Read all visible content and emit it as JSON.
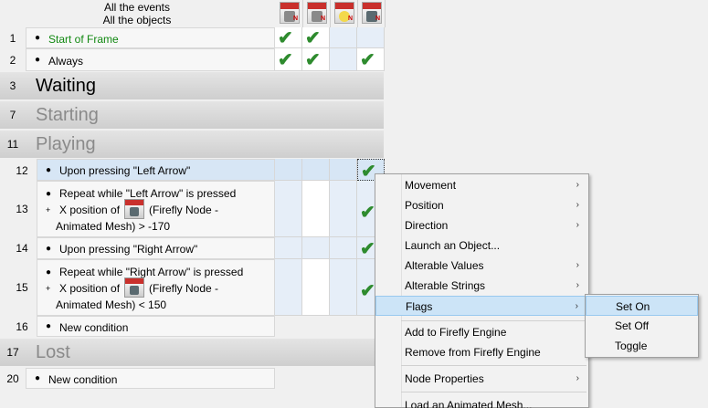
{
  "header": {
    "line1": "All the events",
    "line2": "All the objects"
  },
  "objects": [
    {
      "icon": "firefly-engine-icon"
    },
    {
      "icon": "firefly-mesh-icon"
    },
    {
      "icon": "firefly-light-icon"
    },
    {
      "icon": "firefly-node-icon"
    }
  ],
  "rows": {
    "r1": {
      "num": "1",
      "text": "Start of Frame"
    },
    "r2": {
      "num": "2",
      "text": "Always"
    },
    "g3": {
      "num": "3",
      "title": "Waiting"
    },
    "g7": {
      "num": "7",
      "title": "Starting"
    },
    "g11": {
      "num": "11",
      "title": "Playing"
    },
    "r12": {
      "num": "12",
      "text": "Upon pressing \"Left Arrow\""
    },
    "r13": {
      "num": "13",
      "line1": "Repeat while \"Left Arrow\" is pressed",
      "line2a": "X position of",
      "line2b": "(Firefly Node -",
      "line3": "Animated Mesh) > -170"
    },
    "r14": {
      "num": "14",
      "text": "Upon pressing \"Right Arrow\""
    },
    "r15": {
      "num": "15",
      "line1": "Repeat while \"Right Arrow\" is pressed",
      "line2a": "X position of",
      "line2b": "(Firefly Node -",
      "line3": "Animated Mesh) < 150"
    },
    "r16": {
      "num": "16",
      "text": "New condition"
    },
    "g17": {
      "num": "17",
      "title": "Lost"
    },
    "r20": {
      "num": "20",
      "text": "New condition"
    }
  },
  "check_glyph": "✔",
  "context_menu": {
    "items": [
      {
        "label": "Movement",
        "submenu": true
      },
      {
        "label": "Position",
        "submenu": true
      },
      {
        "label": "Direction",
        "submenu": true
      },
      {
        "label": "Launch an Object...",
        "submenu": false
      },
      {
        "label": "Alterable Values",
        "submenu": true
      },
      {
        "label": "Alterable Strings",
        "submenu": true
      },
      {
        "label": "Flags",
        "submenu": true
      },
      {
        "label": "Add to Firefly Engine",
        "submenu": false
      },
      {
        "label": "Remove from Firefly Engine",
        "submenu": false
      },
      {
        "label": "Node Properties",
        "submenu": true
      },
      {
        "label": "Load an Animated Mesh...",
        "submenu": false
      }
    ],
    "arrow": "›"
  },
  "flags_submenu": {
    "items": [
      {
        "label": "Set On"
      },
      {
        "label": "Set Off"
      },
      {
        "label": "Toggle"
      }
    ]
  }
}
